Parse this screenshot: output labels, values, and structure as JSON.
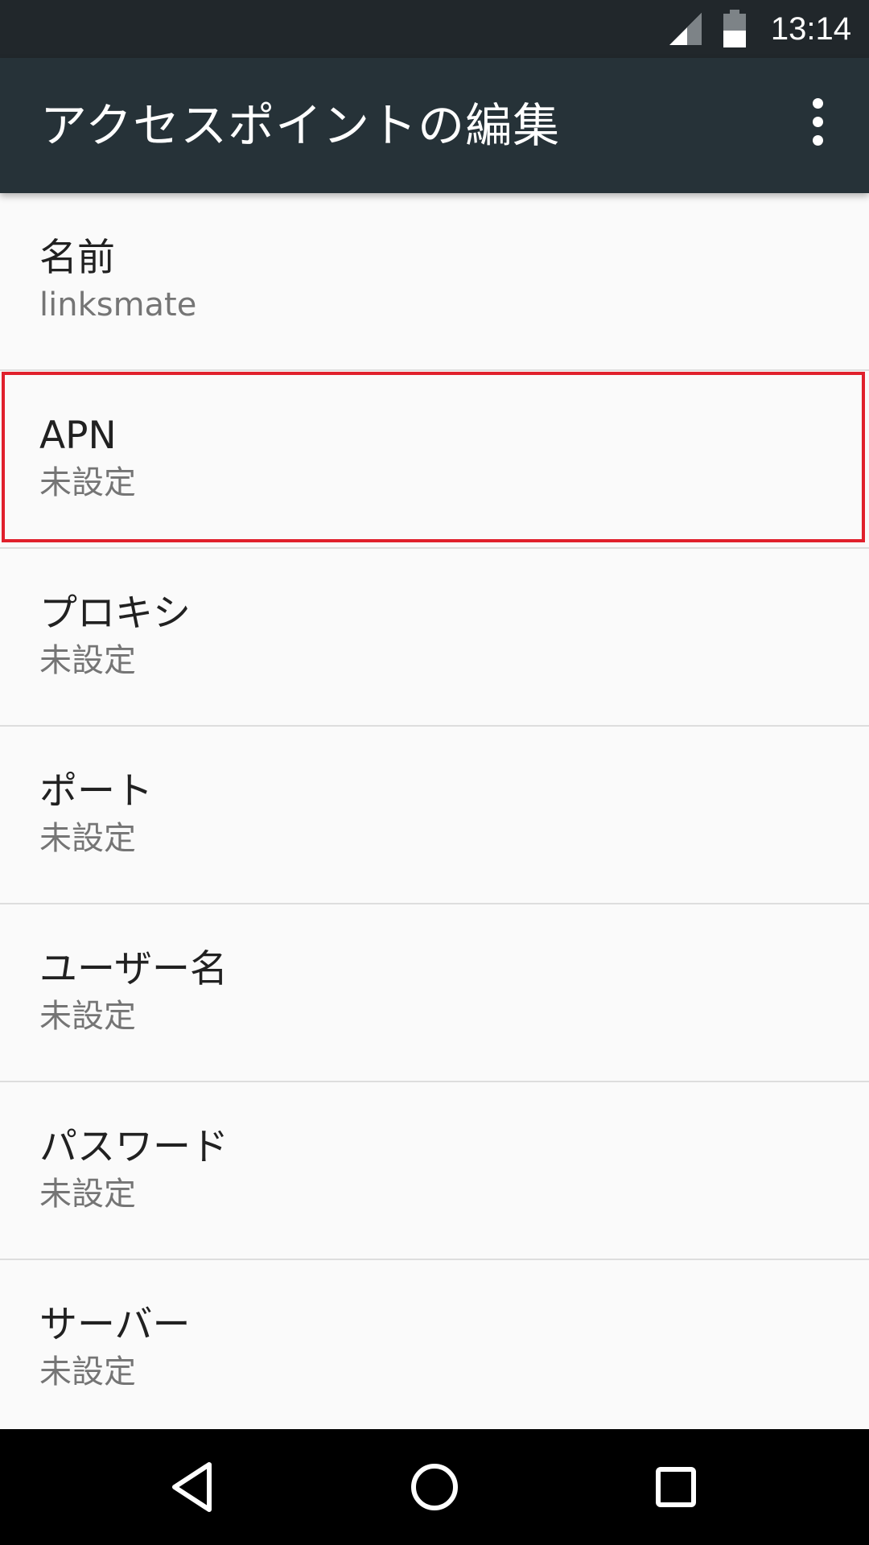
{
  "status_bar": {
    "time": "13:14",
    "icons": [
      "signal-icon",
      "battery-icon"
    ]
  },
  "app_bar": {
    "title": "アクセスポイントの編集",
    "menu_icon": "more-vert-icon"
  },
  "preferences": [
    {
      "title": "名前",
      "summary": "linksmate"
    },
    {
      "title": "APN",
      "summary": "未設定"
    },
    {
      "title": "プロキシ",
      "summary": "未設定"
    },
    {
      "title": "ポート",
      "summary": "未設定"
    },
    {
      "title": "ユーザー名",
      "summary": "未設定"
    },
    {
      "title": "パスワード",
      "summary": "未設定"
    },
    {
      "title": "サーバー",
      "summary": "未設定"
    }
  ],
  "highlight": {
    "target": "APN",
    "color": "#e0202c"
  },
  "nav_bar": {
    "icons": [
      "back-icon",
      "home-icon",
      "recents-icon"
    ]
  },
  "colors": {
    "status_bar": "#21272b",
    "app_bar": "#263238",
    "background": "#fafafa"
  }
}
